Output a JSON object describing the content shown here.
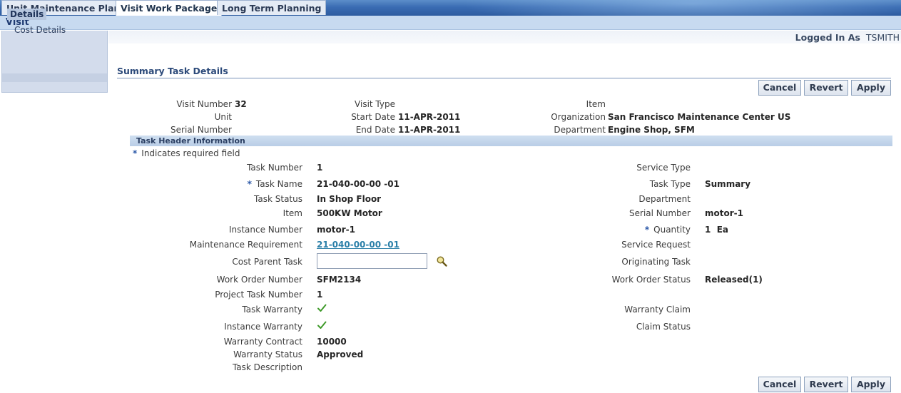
{
  "tabs": [
    "Unit Maintenance Plan",
    "Visit Work Package",
    "Long Term Planning"
  ],
  "subtab": "Visit",
  "nav": {
    "selected": "Details",
    "items": [
      "Cost Details"
    ]
  },
  "login": {
    "label": "Logged In As",
    "user": "TSMITH"
  },
  "section_title": "Summary Task Details",
  "buttons": {
    "cancel": "Cancel",
    "revert": "Revert",
    "apply": "Apply"
  },
  "summary": {
    "visit_number_label": "Visit Number",
    "visit_number": "32",
    "unit_label": "Unit",
    "unit": "",
    "serial_label": "Serial Number",
    "serial": "",
    "visit_type_label": "Visit Type",
    "visit_type": "",
    "start_date_label": "Start Date",
    "start_date": "11-APR-2011",
    "end_date_label": "End Date",
    "end_date": "11-APR-2011",
    "item_label": "Item",
    "item": "",
    "org_label": "Organization",
    "org": "San Francisco Maintenance Center US",
    "dept_label": "Department",
    "dept": "Engine Shop, SFM"
  },
  "task_header": "Task Header Information",
  "required_note": "Indicates required field",
  "required_mark": "*",
  "left_fields": {
    "task_number_label": "Task Number",
    "task_number": "1",
    "task_name_label": "Task Name",
    "task_name": "21-040-00-00 -01",
    "task_status_label": "Task Status",
    "task_status": "In Shop Floor",
    "item_label": "Item",
    "item": "500KW Motor",
    "instance_label": "Instance Number",
    "instance": "motor-1",
    "mr_label": "Maintenance Requirement",
    "mr": "21-040-00-00 -01",
    "cost_parent_label": "Cost Parent Task",
    "cost_parent": "",
    "wo_number_label": "Work Order Number",
    "wo_number": "SFM2134",
    "project_task_label": "Project Task Number",
    "project_task": "1",
    "task_warranty_label": "Task Warranty",
    "instance_warranty_label": "Instance Warranty",
    "warranty_contract_label": "Warranty Contract",
    "warranty_contract": "10000",
    "warranty_status_label": "Warranty Status",
    "warranty_status": "Approved",
    "task_desc_label": "Task Description",
    "task_desc": ""
  },
  "right_fields": {
    "service_type_label": "Service Type",
    "service_type": "",
    "task_type_label": "Task Type",
    "task_type": "Summary",
    "department_label": "Department",
    "department": "",
    "serial_label": "Serial Number",
    "serial": "motor-1",
    "quantity_label": "Quantity",
    "quantity": "1",
    "uom": "Ea",
    "service_request_label": "Service Request",
    "service_request": "",
    "originating_label": "Originating Task",
    "originating": "",
    "wo_status_label": "Work Order Status",
    "wo_status": "Released(1)",
    "warranty_claim_label": "Warranty Claim",
    "warranty_claim": "",
    "claim_status_label": "Claim Status",
    "claim_status": ""
  },
  "task_warranty_checked": true,
  "instance_warranty_checked": true,
  "colors": {
    "accent": "#2e5ca0",
    "link": "#2a7fa8",
    "check": "#3f9a2a"
  }
}
